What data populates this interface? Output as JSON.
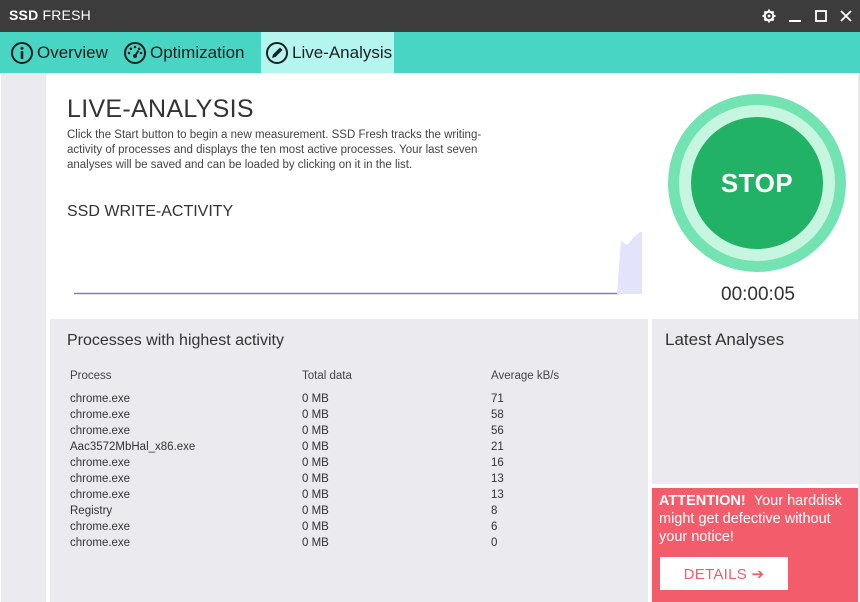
{
  "window": {
    "title_bold": "SSD",
    "title_rest": " FRESH",
    "controls": {
      "settings_icon": "gear-icon",
      "minimize_icon": "minimize-icon",
      "maximize_icon": "maximize-icon",
      "close_icon": "close-icon"
    }
  },
  "tabs": [
    {
      "label": "Overview",
      "icon": "info-icon",
      "active": false
    },
    {
      "label": "Optimization",
      "icon": "speedometer-icon",
      "active": false
    },
    {
      "label": "Live-Analysis",
      "icon": "pencil-icon",
      "active": true
    }
  ],
  "live": {
    "heading": "LIVE-ANALYSIS",
    "description": "Click the Start button to begin a new measurement. SSD Fresh tracks the writing-activity of processes and displays the ten most active processes. Your last seven analyses will be saved and can be loaded by clicking on it in the list.",
    "chart_heading": "SSD WRITE-ACTIVITY"
  },
  "control": {
    "stop_label": "STOP",
    "timer": "00:00:05"
  },
  "processes": {
    "title": "Processes with highest activity",
    "columns": [
      "Process",
      "Total data",
      "Average kB/s"
    ],
    "rows": [
      {
        "process": "chrome.exe",
        "total": "0 MB",
        "avg": "71"
      },
      {
        "process": "chrome.exe",
        "total": "0 MB",
        "avg": "58"
      },
      {
        "process": "chrome.exe",
        "total": "0 MB",
        "avg": "56"
      },
      {
        "process": "Aac3572MbHal_x86.exe",
        "total": "0 MB",
        "avg": "21"
      },
      {
        "process": "chrome.exe",
        "total": "0 MB",
        "avg": "16"
      },
      {
        "process": "chrome.exe",
        "total": "0 MB",
        "avg": "13"
      },
      {
        "process": "chrome.exe",
        "total": "0 MB",
        "avg": "13"
      },
      {
        "process": "Registry",
        "total": "0 MB",
        "avg": "8"
      },
      {
        "process": "chrome.exe",
        "total": "0 MB",
        "avg": "6"
      },
      {
        "process": "chrome.exe",
        "total": "0 MB",
        "avg": "0"
      }
    ]
  },
  "latest": {
    "title": "Latest Analyses"
  },
  "alert": {
    "attention": "ATTENTION!",
    "message": "Your harddisk might get defective without your notice!",
    "button_label": "DETAILS ➔"
  },
  "colors": {
    "titlebar": "#3c3c3c",
    "tabbar": "#48d5c4",
    "tab_active": "#b4f5ef",
    "stop_green": "#22b266",
    "alert_red": "#f35d6b",
    "panel_gray": "#ebebef"
  }
}
